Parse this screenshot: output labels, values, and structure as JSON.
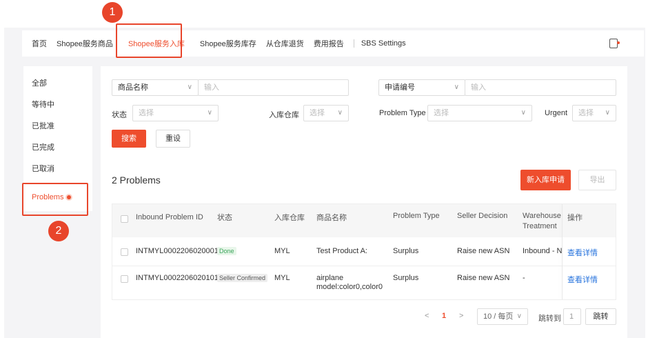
{
  "topnav": {
    "tabs": [
      "首页",
      "Shopee服务商品",
      "Shopee服务入库",
      "Shopee服务库存",
      "从仓库退货",
      "费用报告",
      "SBS Settings"
    ],
    "active_tab": 2
  },
  "sidebar": {
    "items": [
      "全部",
      "等待中",
      "已批准",
      "已完成",
      "已取消",
      "Problems"
    ],
    "active_item": 5
  },
  "filters": {
    "product_name_select": "商品名称",
    "product_name_placeholder": "输入",
    "application_no_select": "申请编号",
    "application_no_placeholder": "输入",
    "status_label": "状态",
    "status_placeholder": "选择",
    "warehouse_label": "入库仓库",
    "warehouse_placeholder": "选择",
    "problem_type_label": "Problem Type",
    "problem_type_placeholder": "选择",
    "urgent_label": "Urgent",
    "urgent_placeholder": "选择",
    "search_label": "搜索",
    "reset_label": "重设"
  },
  "summary": {
    "count_label": "2 Problems",
    "new_button": "新入库申请",
    "export_button": "导出"
  },
  "table": {
    "headers": [
      "Inbound Problem ID",
      "状态",
      "入库仓库",
      "商品名称",
      "Problem Type",
      "Seller Decision",
      "Warehouse",
      "Treatment",
      "操作"
    ],
    "rows": [
      {
        "id": "INTMYL0002206020001",
        "status": "Done",
        "warehouse": "MYL",
        "product": "Test Product A:",
        "product2": "",
        "problem_type": "Surplus",
        "decision": "Raise new ASN",
        "treatment": "Inbound - New",
        "action": "查看详情"
      },
      {
        "id": "INTMYL0002206020101",
        "status": "Seller Confirmed",
        "warehouse": "MYL",
        "product": "airplane",
        "product2": "model:color0,color0",
        "problem_type": "Surplus",
        "decision": "Raise new ASN",
        "treatment": "-",
        "action": "查看详情"
      }
    ]
  },
  "pagination": {
    "prev": "<",
    "current": "1",
    "next": ">",
    "page_size": "10 / 每页",
    "jump_label": "跳转到",
    "jump_value": "1",
    "jump_button": "跳转"
  },
  "annotations": {
    "badge1": "1",
    "badge2": "2"
  },
  "colors": {
    "accent": "#ee4d2d",
    "annotation": "#e8452b",
    "link": "#2673dd",
    "done_tag": "#3aa55a"
  }
}
